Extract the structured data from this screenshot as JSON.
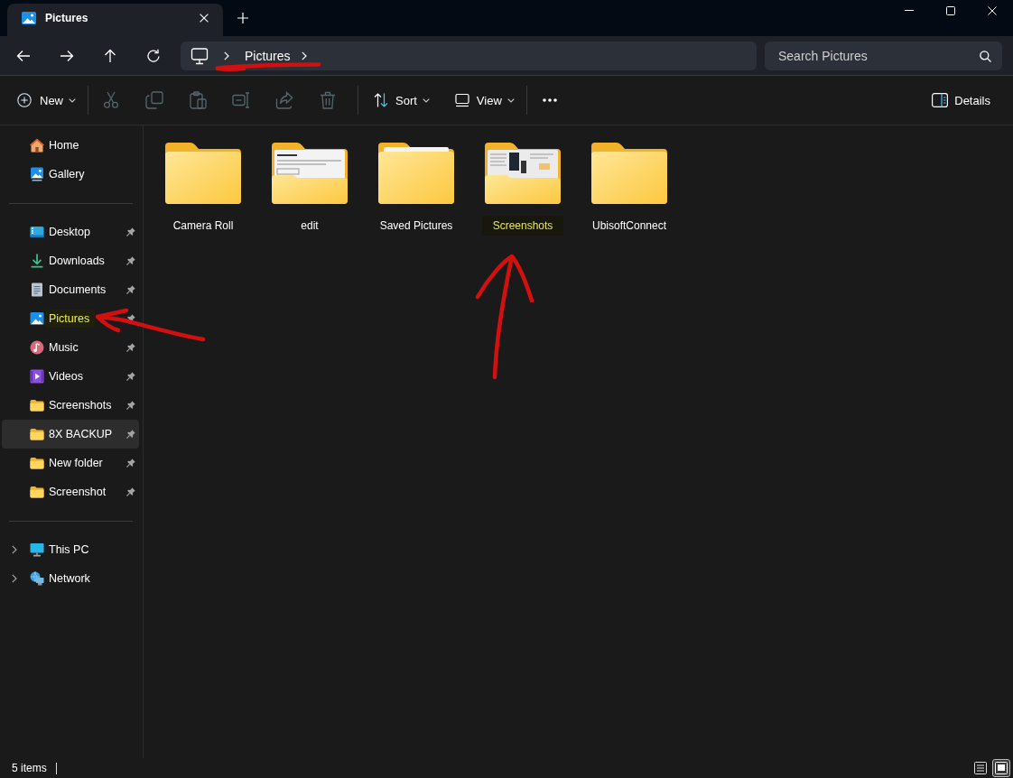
{
  "tab": {
    "title": "Pictures"
  },
  "address": {
    "crumbs": [
      {
        "label": "Pictures"
      }
    ]
  },
  "search": {
    "placeholder": "Search Pictures"
  },
  "toolbar": {
    "new": {
      "label": "New"
    },
    "actions": [
      {
        "kind": "cut",
        "disabled": true
      },
      {
        "kind": "copy",
        "disabled": true
      },
      {
        "kind": "paste",
        "disabled": true
      },
      {
        "kind": "rename",
        "disabled": true
      },
      {
        "kind": "share",
        "disabled": true
      },
      {
        "kind": "delete",
        "disabled": true
      }
    ],
    "sort": {
      "label": "Sort"
    },
    "view": {
      "label": "View"
    },
    "details": {
      "label": "Details"
    }
  },
  "sidebar": {
    "top": [
      {
        "label": "Home",
        "kind": "home"
      },
      {
        "label": "Gallery",
        "kind": "gallery"
      }
    ],
    "quick_access": [
      {
        "label": "Desktop",
        "kind": "desktop",
        "pinned": true,
        "hovered": false,
        "highlighted": false
      },
      {
        "label": "Downloads",
        "kind": "downloads",
        "pinned": true,
        "hovered": false,
        "highlighted": false
      },
      {
        "label": "Documents",
        "kind": "documents",
        "pinned": true,
        "hovered": false,
        "highlighted": false
      },
      {
        "label": "Pictures",
        "kind": "pictures",
        "pinned": true,
        "hovered": false,
        "highlighted": true
      },
      {
        "label": "Music",
        "kind": "music",
        "pinned": true,
        "hovered": false,
        "highlighted": false
      },
      {
        "label": "Videos",
        "kind": "videos",
        "pinned": true,
        "hovered": false,
        "highlighted": false
      },
      {
        "label": "Screenshots",
        "kind": "folder",
        "pinned": true,
        "hovered": false,
        "highlighted": false
      },
      {
        "label": "8X BACKUP",
        "kind": "folder",
        "pinned": true,
        "hovered": true,
        "highlighted": false
      },
      {
        "label": "New folder",
        "kind": "folder",
        "pinned": true,
        "hovered": false,
        "highlighted": false
      },
      {
        "label": "Screenshot",
        "kind": "folder",
        "pinned": true,
        "hovered": false,
        "highlighted": false
      }
    ],
    "locations": [
      {
        "label": "This PC",
        "kind": "pc",
        "expanded": false
      },
      {
        "label": "Network",
        "kind": "network",
        "expanded": false
      }
    ]
  },
  "folders": [
    {
      "name": "Camera Roll",
      "kind": "plain",
      "highlighted": false
    },
    {
      "name": "edit",
      "kind": "document",
      "highlighted": false
    },
    {
      "name": "Saved Pictures",
      "kind": "paper",
      "highlighted": false
    },
    {
      "name": "Screenshots",
      "kind": "screenshots",
      "highlighted": true
    },
    {
      "name": "UbisoftConnect",
      "kind": "plain",
      "highlighted": false
    }
  ],
  "status_bar": {
    "count": "5 items",
    "views": [
      {
        "kind": "details",
        "selected": false
      },
      {
        "kind": "large-icons",
        "selected": true
      }
    ]
  },
  "annotations": [
    {
      "kind": "underline"
    },
    {
      "kind": "curved-arrow"
    },
    {
      "kind": "up-arrow"
    }
  ]
}
